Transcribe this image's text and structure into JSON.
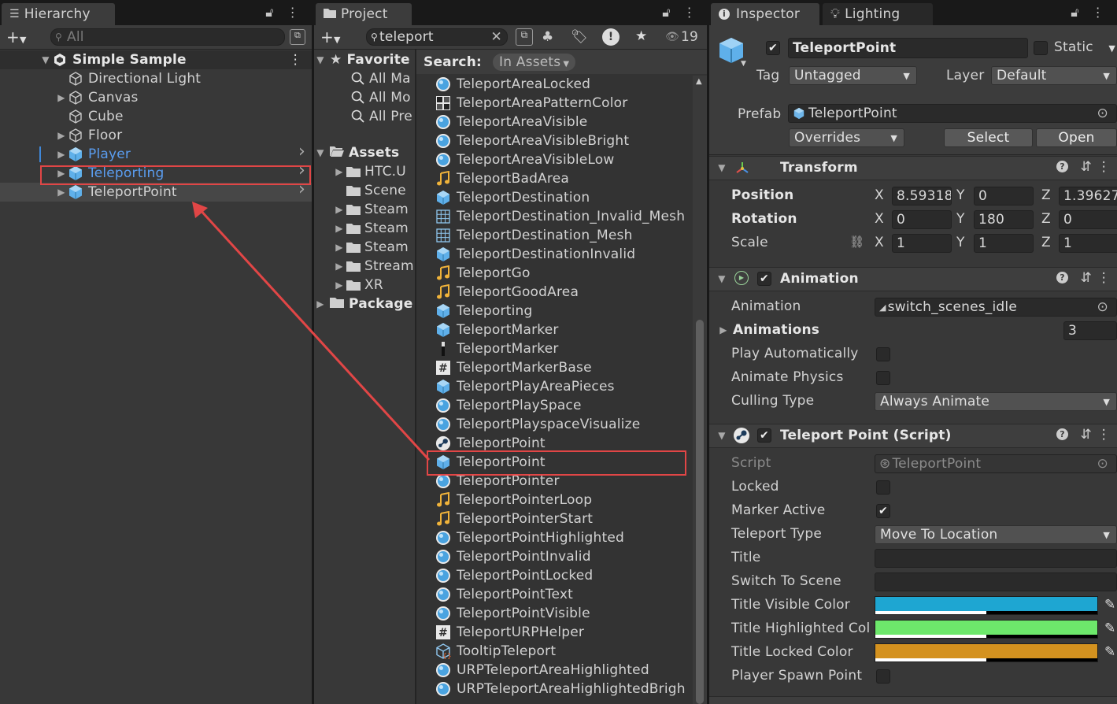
{
  "hierarchy": {
    "tab": "Hierarchy",
    "search_placeholder": "All",
    "scene": "Simple Sample",
    "items": [
      {
        "label": "Directional Light",
        "icon": "cube-outline-icon"
      },
      {
        "label": "Canvas",
        "icon": "cube-outline-icon"
      },
      {
        "label": "Cube",
        "icon": "cube-outline-icon"
      },
      {
        "label": "Floor",
        "icon": "cube-outline-icon"
      },
      {
        "label": "Player",
        "icon": "prefab-cube-icon"
      },
      {
        "label": "Teleporting",
        "icon": "prefab-cube-icon"
      },
      {
        "label": "TeleportPoint",
        "icon": "prefab-cube-icon"
      }
    ]
  },
  "project": {
    "tab": "Project",
    "search_value": "teleport",
    "hidden_count": "19",
    "search_label": "Search:",
    "search_scope": "In Assets",
    "favorites": {
      "label": "Favorite",
      "items": [
        "All Ma",
        "All Mo",
        "All Pre"
      ]
    },
    "assets": {
      "label": "Assets",
      "items": [
        "HTC.U",
        "Scene",
        "Steam",
        "Steam",
        "Steam",
        "Stream",
        "XR"
      ]
    },
    "packages": "Package",
    "results": [
      {
        "label": "TeleportAreaLocked",
        "icon": "material-sphere-icon"
      },
      {
        "label": "TeleportAreaPatternColor",
        "icon": "texture-checker-icon"
      },
      {
        "label": "TeleportAreaVisible",
        "icon": "material-sphere-icon"
      },
      {
        "label": "TeleportAreaVisibleBright",
        "icon": "material-sphere-icon"
      },
      {
        "label": "TeleportAreaVisibleLow",
        "icon": "material-sphere-icon"
      },
      {
        "label": "TeleportBadArea",
        "icon": "audio-note-icon"
      },
      {
        "label": "TeleportDestination",
        "icon": "prefab-cube-icon"
      },
      {
        "label": "TeleportDestination_Invalid_Mesh",
        "icon": "mesh-grid-icon"
      },
      {
        "label": "TeleportDestination_Mesh",
        "icon": "mesh-grid-icon"
      },
      {
        "label": "TeleportDestinationInvalid",
        "icon": "prefab-cube-icon"
      },
      {
        "label": "TeleportGo",
        "icon": "audio-note-icon"
      },
      {
        "label": "TeleportGoodArea",
        "icon": "audio-note-icon"
      },
      {
        "label": "Teleporting",
        "icon": "prefab-cube-icon"
      },
      {
        "label": "TeleportMarker",
        "icon": "prefab-cube-icon"
      },
      {
        "label": "TeleportMarker",
        "icon": "shader-bar-icon"
      },
      {
        "label": "TeleportMarkerBase",
        "icon": "script-hash-icon"
      },
      {
        "label": "TeleportPlayAreaPieces",
        "icon": "prefab-cube-icon"
      },
      {
        "label": "TeleportPlaySpace",
        "icon": "material-sphere-icon"
      },
      {
        "label": "TeleportPlayspaceVisualize",
        "icon": "material-sphere-icon"
      },
      {
        "label": "TeleportPoint",
        "icon": "steam-script-icon"
      },
      {
        "label": "TeleportPoint",
        "icon": "prefab-cube-icon"
      },
      {
        "label": "TeleportPointer",
        "icon": "material-sphere-icon"
      },
      {
        "label": "TeleportPointerLoop",
        "icon": "audio-note-icon"
      },
      {
        "label": "TeleportPointerStart",
        "icon": "audio-note-icon"
      },
      {
        "label": "TeleportPointHighlighted",
        "icon": "material-sphere-icon"
      },
      {
        "label": "TeleportPointInvalid",
        "icon": "material-sphere-icon"
      },
      {
        "label": "TeleportPointLocked",
        "icon": "material-sphere-icon"
      },
      {
        "label": "TeleportPointText",
        "icon": "material-sphere-icon"
      },
      {
        "label": "TeleportPointVisible",
        "icon": "material-sphere-icon"
      },
      {
        "label": "TeleportURPHelper",
        "icon": "script-hash-icon"
      },
      {
        "label": "TooltipTeleport",
        "icon": "prefab-variant-icon"
      },
      {
        "label": "URPTeleportAreaHighlighted",
        "icon": "material-sphere-icon"
      },
      {
        "label": "URPTeleportAreaHighlightedBrigh",
        "icon": "material-sphere-icon"
      }
    ]
  },
  "inspector": {
    "tab": "Inspector",
    "tab2": "Lighting",
    "object_name": "TeleportPoint",
    "static_label": "Static",
    "tag_label": "Tag",
    "tag_value": "Untagged",
    "layer_label": "Layer",
    "layer_value": "Default",
    "prefab_label": "Prefab",
    "prefab_value": "TeleportPoint",
    "overrides": "Overrides",
    "select_btn": "Select",
    "open_btn": "Open",
    "transform": {
      "title": "Transform",
      "position_label": "Position",
      "rotation_label": "Rotation",
      "scale_label": "Scale",
      "axis_x": "X",
      "axis_y": "Y",
      "axis_z": "Z",
      "position": [
        "8.59318",
        "0",
        "1.39627"
      ],
      "rotation": [
        "0",
        "180",
        "0"
      ],
      "scale": [
        "1",
        "1",
        "1"
      ]
    },
    "animation": {
      "title": "Animation",
      "animation_label": "Animation",
      "animation_value": "switch_scenes_idle",
      "animations_label": "Animations",
      "animations_count": "3",
      "play_auto_label": "Play Automatically",
      "animate_physics_label": "Animate Physics",
      "culling_label": "Culling Type",
      "culling_value": "Always Animate"
    },
    "teleport_point": {
      "title": "Teleport Point (Script)",
      "script_label": "Script",
      "script_value": "TeleportPoint",
      "locked_label": "Locked",
      "marker_active_label": "Marker Active",
      "teleport_type_label": "Teleport Type",
      "teleport_type_value": "Move To Location",
      "title_label": "Title",
      "switch_scene_label": "Switch To Scene",
      "visible_color_label": "Title Visible Color",
      "highlighted_color_label": "Title Highlighted Col",
      "locked_color_label": "Title Locked Color",
      "spawn_label": "Player Spawn Point",
      "visible_color": "#1ea6d2",
      "highlighted_color": "#6de86b",
      "locked_color": "#d4921f"
    }
  },
  "colors": {
    "selection_box": "#e14646",
    "prefab_blue": "#6fb6ea",
    "player_text": "#5a9df0"
  }
}
